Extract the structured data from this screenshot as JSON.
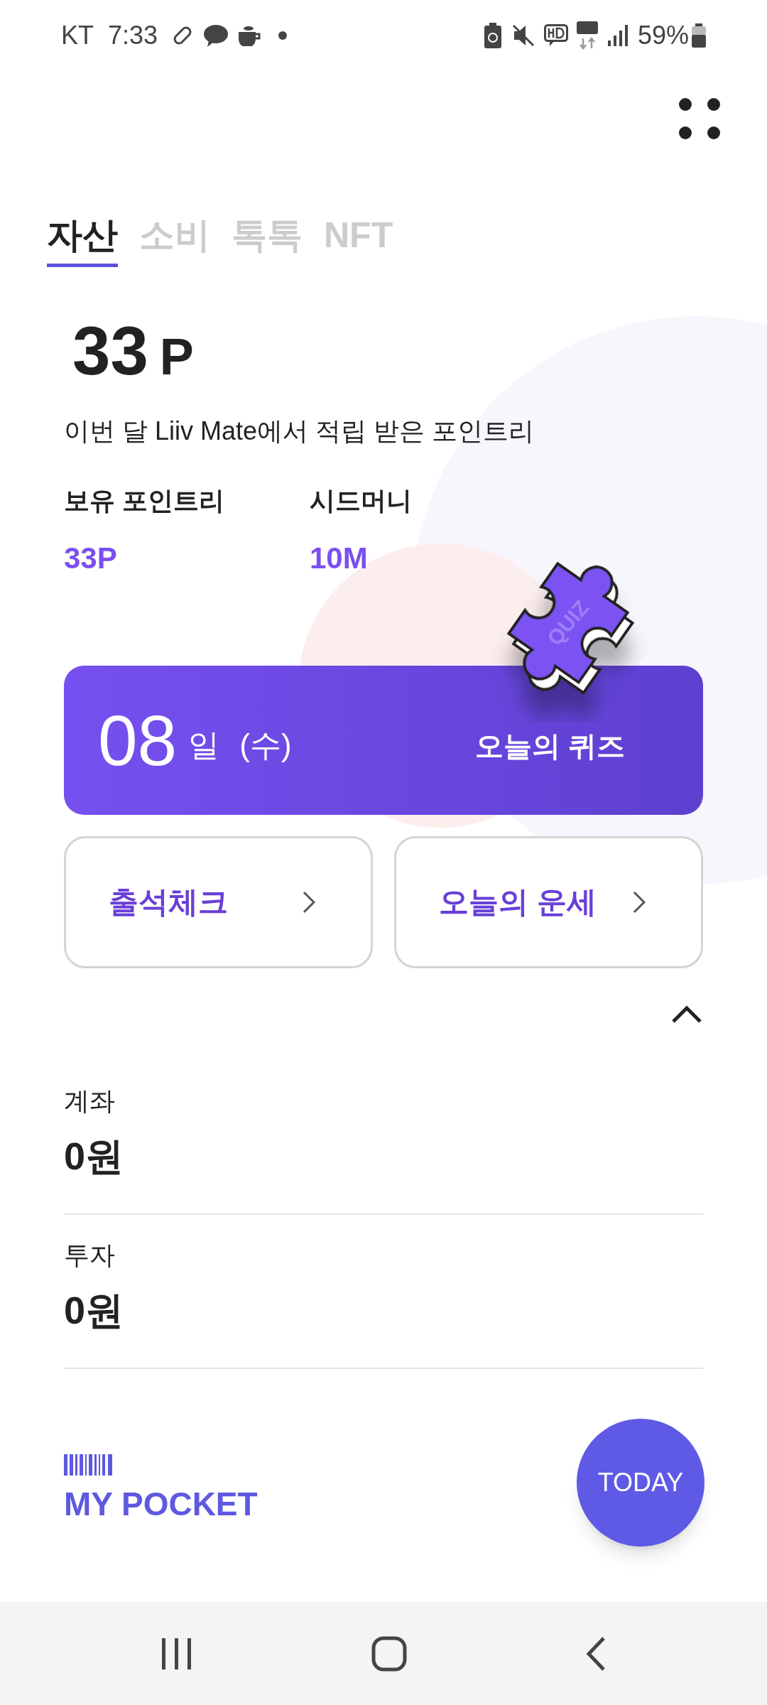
{
  "status_bar": {
    "carrier": "KT",
    "time": "7:33",
    "battery": "59%"
  },
  "tabs": [
    {
      "label": "자산",
      "selected": true
    },
    {
      "label": "소비",
      "selected": false
    },
    {
      "label": "톡톡",
      "selected": false
    },
    {
      "label": "NFT",
      "selected": false
    }
  ],
  "points": {
    "amount": "33",
    "unit": "P",
    "caption": "이번 달 Liiv Mate에서 적립 받은 포인트리"
  },
  "stats": [
    {
      "label": "보유 포인트리",
      "value": "33P"
    },
    {
      "label": "시드머니",
      "value": "10M"
    }
  ],
  "quiz_card": {
    "day": "08",
    "day_unit": "일",
    "weekday": "(수)",
    "title": "오늘의 퀴즈",
    "badge": "QUIZ"
  },
  "shortcuts": [
    {
      "label": "출석체크"
    },
    {
      "label": "오늘의 운세"
    }
  ],
  "section": {
    "expanded": true
  },
  "assets": [
    {
      "label": "계좌",
      "value": "0원"
    },
    {
      "label": "투자",
      "value": "0원"
    }
  ],
  "pocket": {
    "title": "MY POCKET"
  },
  "fab": {
    "label": "TODAY"
  }
}
